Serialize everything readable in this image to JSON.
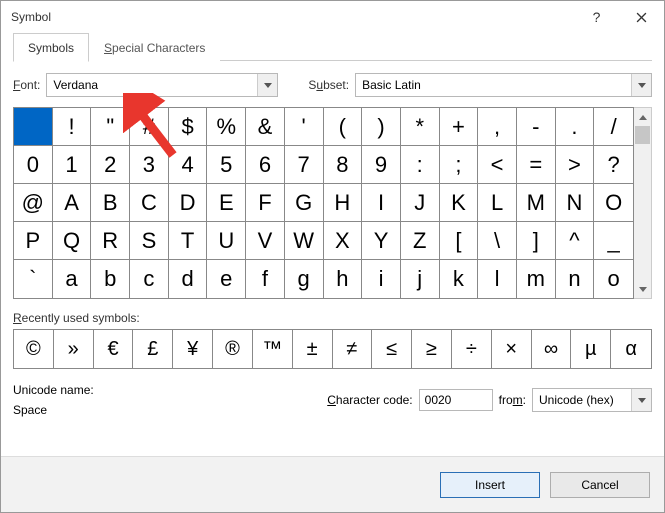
{
  "window": {
    "title": "Symbol"
  },
  "tabs": [
    {
      "label": "Symbols",
      "active": true
    },
    {
      "label": "Special Characters",
      "active": false
    }
  ],
  "font": {
    "label": "Font:",
    "value": "Verdana"
  },
  "subset": {
    "label": "Subset:",
    "value": "Basic Latin"
  },
  "grid": {
    "columns": 16,
    "cells": [
      " ",
      "!",
      "\"",
      "#",
      "$",
      "%",
      "&",
      "'",
      "(",
      ")",
      "*",
      "+",
      ",",
      "-",
      ".",
      "/",
      "0",
      "1",
      "2",
      "3",
      "4",
      "5",
      "6",
      "7",
      "8",
      "9",
      ":",
      ";",
      "<",
      "=",
      ">",
      "?",
      "@",
      "A",
      "B",
      "C",
      "D",
      "E",
      "F",
      "G",
      "H",
      "I",
      "J",
      "K",
      "L",
      "M",
      "N",
      "O",
      "P",
      "Q",
      "R",
      "S",
      "T",
      "U",
      "V",
      "W",
      "X",
      "Y",
      "Z",
      "[",
      "\\",
      "]",
      "^",
      "_",
      "`",
      "a",
      "b",
      "c",
      "d",
      "e",
      "f",
      "g",
      "h",
      "i",
      "j",
      "k",
      "l",
      "m",
      "n",
      "o"
    ],
    "selected_index": 0
  },
  "recent": {
    "label": "Recently used symbols:",
    "cells": [
      "©",
      "»",
      "€",
      "£",
      "¥",
      "®",
      "™",
      "±",
      "≠",
      "≤",
      "≥",
      "÷",
      "×",
      "∞",
      "µ",
      "α"
    ]
  },
  "unicode_name": {
    "label": "Unicode name:",
    "value": "Space"
  },
  "char_code": {
    "label": "Character code:",
    "value": "0020"
  },
  "from": {
    "label": "from:",
    "value": "Unicode (hex)"
  },
  "buttons": {
    "insert": "Insert",
    "cancel": "Cancel"
  }
}
